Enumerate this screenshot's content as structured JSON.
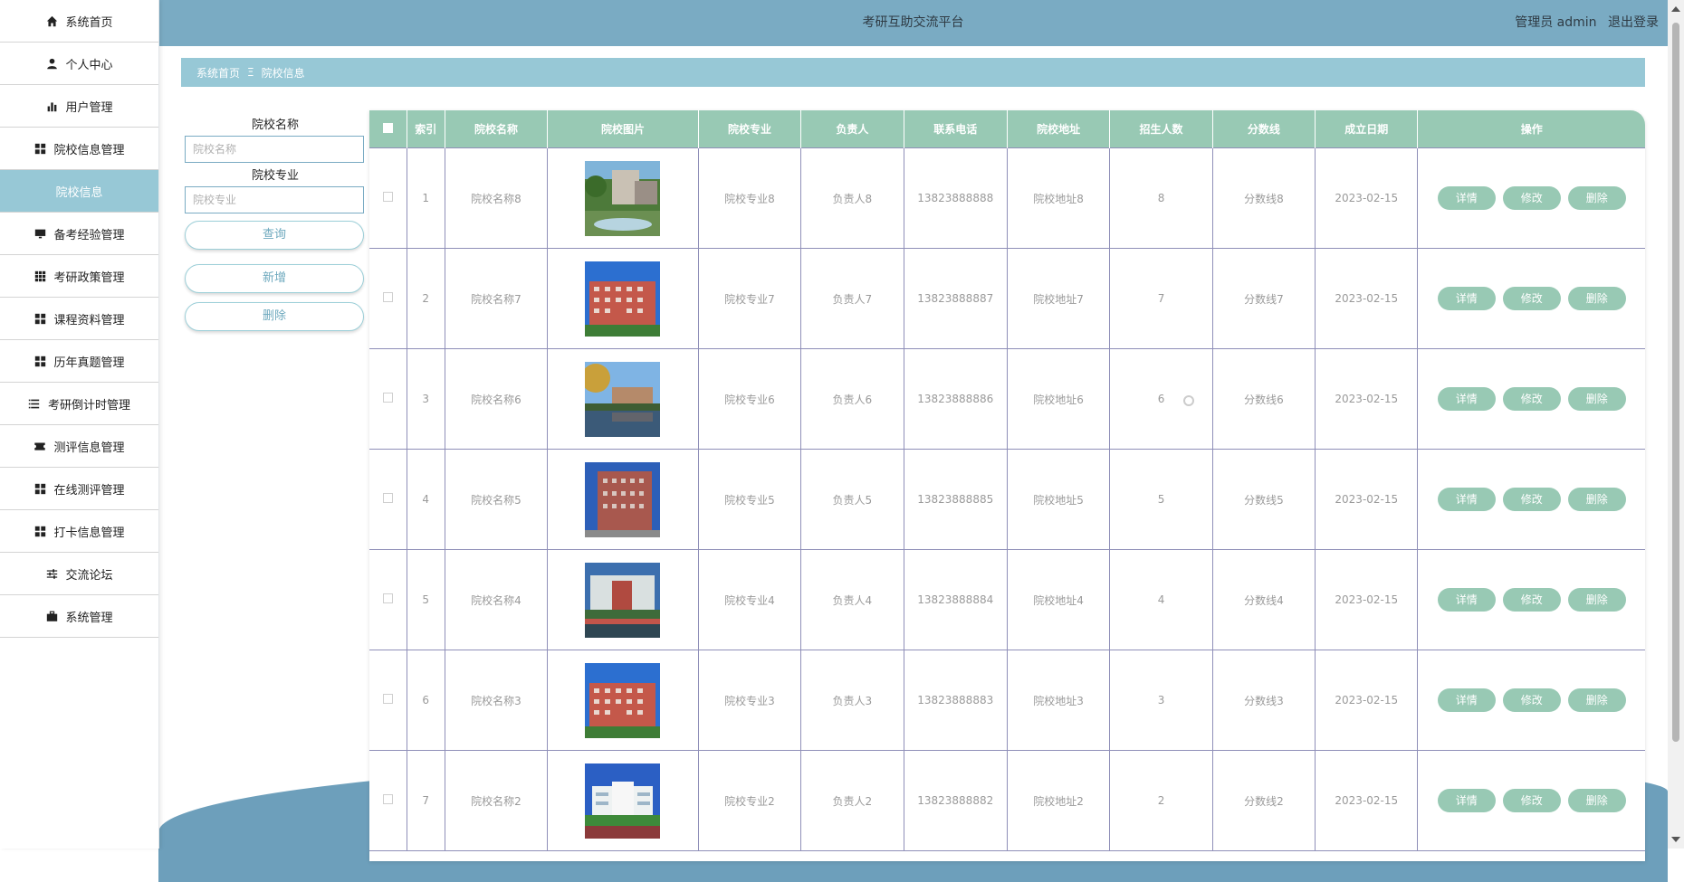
{
  "app": {
    "title": "考研互助交流平台",
    "user_label": "管理员 admin",
    "logout_label": "退出登录"
  },
  "sidebar": {
    "items": [
      {
        "label": "系统首页",
        "icon": "home-icon"
      },
      {
        "label": "个人中心",
        "icon": "user-icon"
      },
      {
        "label": "用户管理",
        "icon": "bar-chart-icon"
      },
      {
        "label": "院校信息管理",
        "icon": "grid-icon"
      },
      {
        "label": "院校信息",
        "icon": "",
        "active": true
      },
      {
        "label": "备考经验管理",
        "icon": "monitor-icon"
      },
      {
        "label": "考研政策管理",
        "icon": "apps-icon"
      },
      {
        "label": "课程资料管理",
        "icon": "grid-icon"
      },
      {
        "label": "历年真题管理",
        "icon": "grid-icon"
      },
      {
        "label": "考研倒计时管理",
        "icon": "list-icon"
      },
      {
        "label": "测评信息管理",
        "icon": "ticket-icon"
      },
      {
        "label": "在线测评管理",
        "icon": "grid-icon"
      },
      {
        "label": "打卡信息管理",
        "icon": "grid-icon"
      },
      {
        "label": "交流论坛",
        "icon": "sliders-icon"
      },
      {
        "label": "系统管理",
        "icon": "briefcase-icon"
      }
    ]
  },
  "breadcrumb": {
    "home": "系统首页",
    "separator": "Ξ",
    "current": "院校信息"
  },
  "search": {
    "name_label": "院校名称",
    "name_placeholder": "院校名称",
    "major_label": "院校专业",
    "major_placeholder": "院校专业",
    "query_button": "查询",
    "add_button": "新增",
    "delete_button": "删除"
  },
  "table": {
    "headers": [
      "索引",
      "院校名称",
      "院校图片",
      "院校专业",
      "负责人",
      "联系电话",
      "院校地址",
      "招生人数",
      "分数线",
      "成立日期",
      "操作"
    ],
    "actions": {
      "detail": "详情",
      "edit": "修改",
      "delete": "删除"
    },
    "rows": [
      {
        "index": "1",
        "name": "院校名称8",
        "image": "campus-garden",
        "major": "院校专业8",
        "manager": "负责人8",
        "phone": "13823888888",
        "address": "院校地址8",
        "enrollment": "8",
        "score": "分数线8",
        "date": "2023-02-15"
      },
      {
        "index": "2",
        "name": "院校名称7",
        "image": "red-building",
        "major": "院校专业7",
        "manager": "负责人7",
        "phone": "13823888887",
        "address": "院校地址7",
        "enrollment": "7",
        "score": "分数线7",
        "date": "2023-02-15"
      },
      {
        "index": "3",
        "name": "院校名称6",
        "image": "lake-view",
        "major": "院校专业6",
        "manager": "负责人6",
        "phone": "13823888886",
        "address": "院校地址6",
        "enrollment": "6",
        "score": "分数线6",
        "date": "2023-02-15"
      },
      {
        "index": "4",
        "name": "院校名称5",
        "image": "brick-building",
        "major": "院校专业5",
        "manager": "负责人5",
        "phone": "13823888885",
        "address": "院校地址5",
        "enrollment": "5",
        "score": "分数线5",
        "date": "2023-02-15"
      },
      {
        "index": "5",
        "name": "院校名称4",
        "image": "campus-gate",
        "major": "院校专业4",
        "manager": "负责人4",
        "phone": "13823888884",
        "address": "院校地址4",
        "enrollment": "4",
        "score": "分数线4",
        "date": "2023-02-15"
      },
      {
        "index": "6",
        "name": "院校名称3",
        "image": "red-building",
        "major": "院校专业3",
        "manager": "负责人3",
        "phone": "13823888883",
        "address": "院校地址3",
        "enrollment": "3",
        "score": "分数线3",
        "date": "2023-02-15"
      },
      {
        "index": "7",
        "name": "院校名称2",
        "image": "white-building",
        "major": "院校专业2",
        "manager": "负责人2",
        "phone": "13823888882",
        "address": "院校地址2",
        "enrollment": "2",
        "score": "分数线2",
        "date": "2023-02-15"
      }
    ]
  },
  "colors": {
    "topbar": "#7aabc3",
    "breadcrumb": "#97c8d6",
    "table_header": "#98c9b4",
    "action_button": "#98c9b4",
    "grid_line": "#8f8fb8"
  }
}
